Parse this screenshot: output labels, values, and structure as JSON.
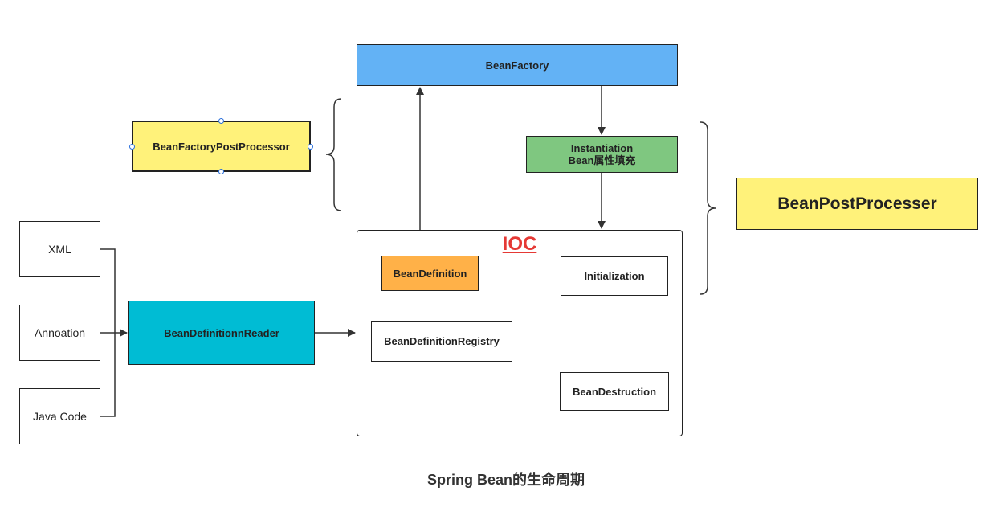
{
  "nodes": {
    "bean_factory": "BeanFactory",
    "bean_factory_post_processor": "BeanFactoryPostProcessor",
    "instantiation_line1": "Instantiation",
    "instantiation_line2": "Bean属性填充",
    "bean_post_processer": "BeanPostProcesser",
    "xml": "XML",
    "annoation": "Annoation",
    "java_code": "Java Code",
    "bean_definition_reader": "BeanDefinitionnReader",
    "ioc_title": "IOC",
    "bean_definition": "BeanDefinition",
    "initialization": "Initialization",
    "bean_definition_registry": "BeanDefinitionRegistry",
    "bean_destruction": "BeanDestruction"
  },
  "caption": "Spring Bean的生命周期",
  "colors": {
    "bean_factory": "#63b2f5",
    "yellow": "#fff27a",
    "green": "#7fc780",
    "reader": "#00bcd4",
    "bean_definition": "#ffb148",
    "ioc_title": "#e53935"
  }
}
